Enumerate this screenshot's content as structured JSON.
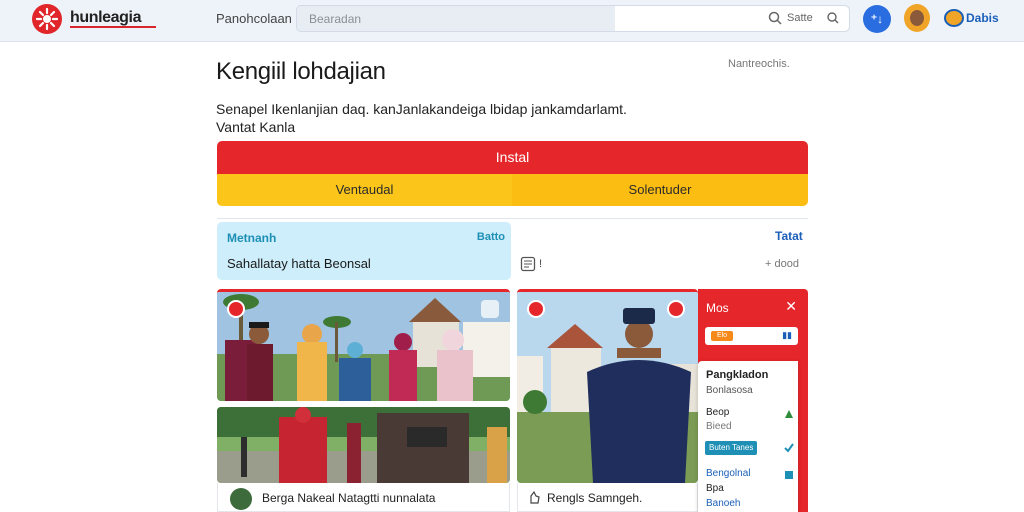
{
  "header": {
    "brand": "hunleagia",
    "nav_link": "Panohcolaan",
    "search_placeholder": "Bearadan",
    "search_right_text": "Satte",
    "blue_button": "⁺↓",
    "user_label": "Dabis"
  },
  "page": {
    "title": "Kengiil lohdajian",
    "meta": "Nantreochis.",
    "description_line1": "Senapel Ikenlanjian daq. kanJanlakandeiga lbidap jankamdarlamt.",
    "description_line2": "Vantat Kanla"
  },
  "actions": {
    "primary": "Instal",
    "secondary_left": "Ventaudal",
    "secondary_right": "Solentuder"
  },
  "info_card": {
    "title": "Metnanh",
    "right_label": "Batto",
    "body": "Sahallatay hatta Beonsal"
  },
  "side_info": {
    "doc_label": "!",
    "title": "Tatat",
    "value": "+ dood"
  },
  "cards": [
    {
      "caption": "Berga Nakeal Natagtti nunnalata"
    },
    {
      "caption": "Rengls Samngeh."
    }
  ],
  "panel": {
    "title": "Mos",
    "close": "✕",
    "tag": "Elo",
    "pill_icon": "▮▮",
    "menu_heading": "Pangkladon",
    "menu_sub": "Bonlasosa",
    "menu_items": [
      "Beop",
      "Bieed",
      "Buten Tanes",
      "Bengolnal",
      "Bpa",
      "Banoeh"
    ]
  },
  "colors": {
    "accent_red": "#e5262b",
    "accent_yellow": "#fbc51a",
    "accent_blue": "#1b5fb8",
    "info_bg": "#cdeefa"
  },
  "icons": [
    "logo-icon",
    "search-icon",
    "search-button-icon",
    "globe-icon",
    "document-icon",
    "close-icon",
    "share-icon",
    "check-icon"
  ]
}
